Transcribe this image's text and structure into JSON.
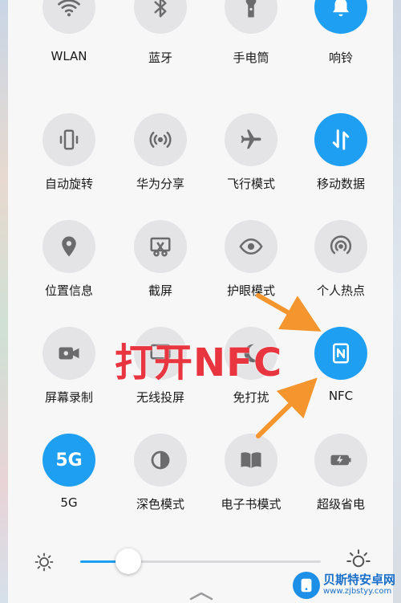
{
  "tiles": [
    {
      "label": "WLAN",
      "icon": "wifi-icon",
      "on": false
    },
    {
      "label": "蓝牙",
      "icon": "bluetooth-icon",
      "on": false
    },
    {
      "label": "手电筒",
      "icon": "flashlight-icon",
      "on": false
    },
    {
      "label": "响铃",
      "icon": "bell-icon",
      "on": true
    },
    {
      "label": "自动旋转",
      "icon": "auto-rotate-icon",
      "on": false
    },
    {
      "label": "华为分享",
      "icon": "huawei-share-icon",
      "on": false
    },
    {
      "label": "飞行模式",
      "icon": "airplane-icon",
      "on": false
    },
    {
      "label": "移动数据",
      "icon": "mobile-data-icon",
      "on": true
    },
    {
      "label": "位置信息",
      "icon": "location-icon",
      "on": false
    },
    {
      "label": "截屏",
      "icon": "screenshot-icon",
      "on": false
    },
    {
      "label": "护眼模式",
      "icon": "eye-icon",
      "on": false
    },
    {
      "label": "个人热点",
      "icon": "hotspot-icon",
      "on": false
    },
    {
      "label": "屏幕录制",
      "icon": "screen-record-icon",
      "on": false
    },
    {
      "label": "无线投屏",
      "icon": "wireless-projection-icon",
      "on": false
    },
    {
      "label": "免打扰",
      "icon": "do-not-disturb-icon",
      "on": false
    },
    {
      "label": "NFC",
      "icon": "nfc-icon",
      "on": true
    },
    {
      "label": "5G",
      "icon": "5g-icon",
      "on": true
    },
    {
      "label": "深色模式",
      "icon": "dark-mode-icon",
      "on": false
    },
    {
      "label": "电子书模式",
      "icon": "ebook-icon",
      "on": false
    },
    {
      "label": "超级省电",
      "icon": "power-saving-icon",
      "on": false
    }
  ],
  "fiveg_text": "5G",
  "brightness": {
    "level": 0.2
  },
  "annotation": {
    "text": "打开NFC",
    "color": "#e8353f"
  },
  "watermark": {
    "title": "贝斯特安卓网",
    "url": "www.zjbstyy.com"
  },
  "colors": {
    "accent": "#1e9ff2",
    "tile_off": "#e4e4e6",
    "icon_off": "#6b6b6e",
    "arrow": "#f4952d"
  }
}
